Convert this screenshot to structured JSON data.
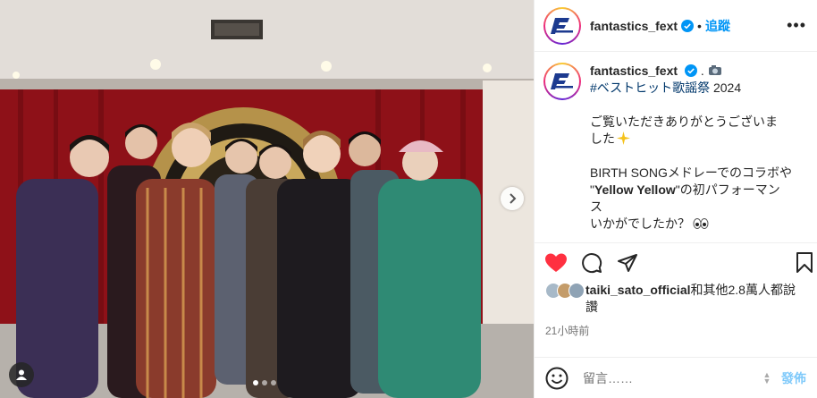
{
  "post": {
    "username": "fantastics_fext",
    "separator": "•",
    "follow_label": "追蹤",
    "more_label": "•••",
    "avatar_text": "F",
    "avatar_subtext": "FANTASTICS"
  },
  "caption": {
    "username": "fantastics_fext",
    "dot": ".",
    "hashtag": "#ベストヒット歌謡祭",
    "hashtag_tail": " 2024",
    "line1": "ご覧いただきありがとうございま",
    "line2": "した",
    "line3_pre": "BIRTH SONGメドレーでのコラボや",
    "line4_quote_open": "\"",
    "line4_bold": "Yellow Yellow",
    "line4_tail": "\"の初パフォーマン",
    "line5": "ス",
    "line6": "いかがでしたか？"
  },
  "likes": {
    "user": "taiki_sato_official",
    "text_tail": "和其他2.8萬人都說",
    "text_line2": "讚"
  },
  "time_ago": "21小時前",
  "comment": {
    "placeholder": "留言……",
    "post_label": "發佈"
  },
  "carousel": {
    "slides": 3,
    "active_index": 0
  },
  "colors": {
    "like_red": "#ff3040",
    "follow_blue": "#0095f6",
    "hashtag_blue": "#00376b",
    "curtain": "#8e1118"
  },
  "icons": [
    "verified-icon",
    "camera-emoji-icon",
    "sparkle-emoji-icon",
    "eyes-emoji-icon",
    "heart-icon",
    "comment-icon",
    "share-icon",
    "save-icon",
    "emoji-icon",
    "user-tag-icon",
    "chevron-right-icon"
  ]
}
